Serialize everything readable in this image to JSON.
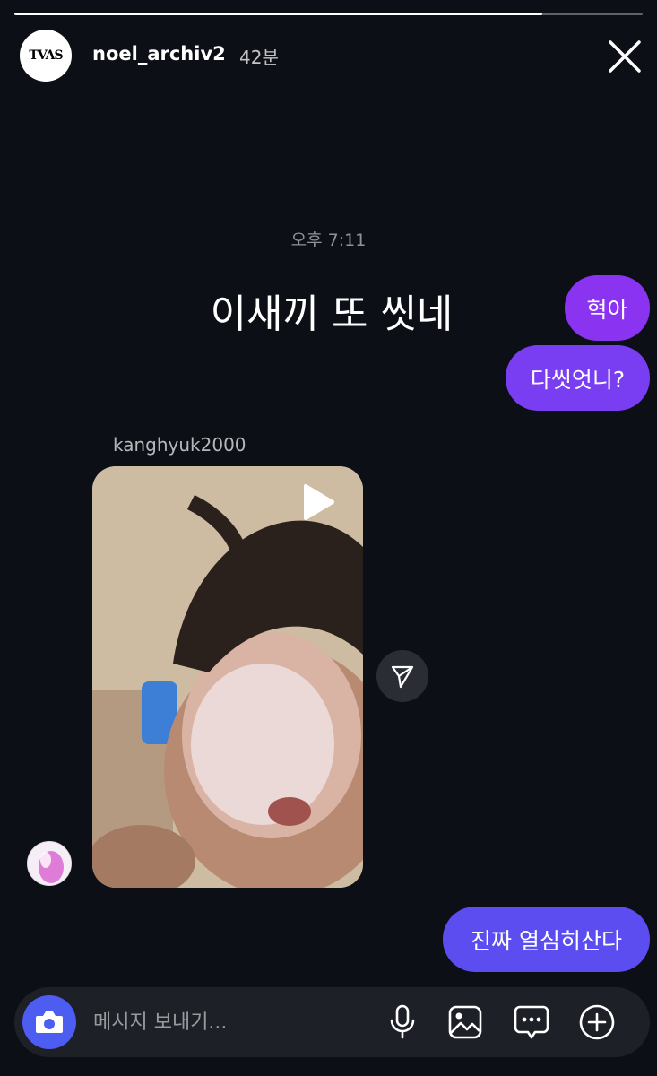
{
  "story": {
    "progress": 0.84,
    "author": {
      "username": "noel_archiv2",
      "time_ago": "42분",
      "avatar_text": "TVAS"
    },
    "timestamp": "오후 7:11",
    "caption": "이새끼 또 씻네"
  },
  "messages": [
    {
      "text": "혁아"
    },
    {
      "text": "다씻엇니?"
    },
    {
      "text": "진짜 열심히산다"
    }
  ],
  "shared_post": {
    "author": "kanghyuk2000"
  },
  "composer": {
    "placeholder": "메시지 보내기..."
  },
  "colors": {
    "background": "#0d0f16",
    "bubble_purple": "#8a33f0",
    "bubble_violet": "#7a3ef2",
    "bubble_blue": "#5b4df0",
    "camera_button": "#4d5df2",
    "composer_bg": "#1e2027"
  },
  "icons": {
    "close": "close-icon",
    "play": "play-icon",
    "share": "send-icon",
    "camera": "camera-icon",
    "mic": "microphone-icon",
    "gallery": "image-icon",
    "sticker": "chat-bubble-icon",
    "more": "plus-circle-icon"
  }
}
